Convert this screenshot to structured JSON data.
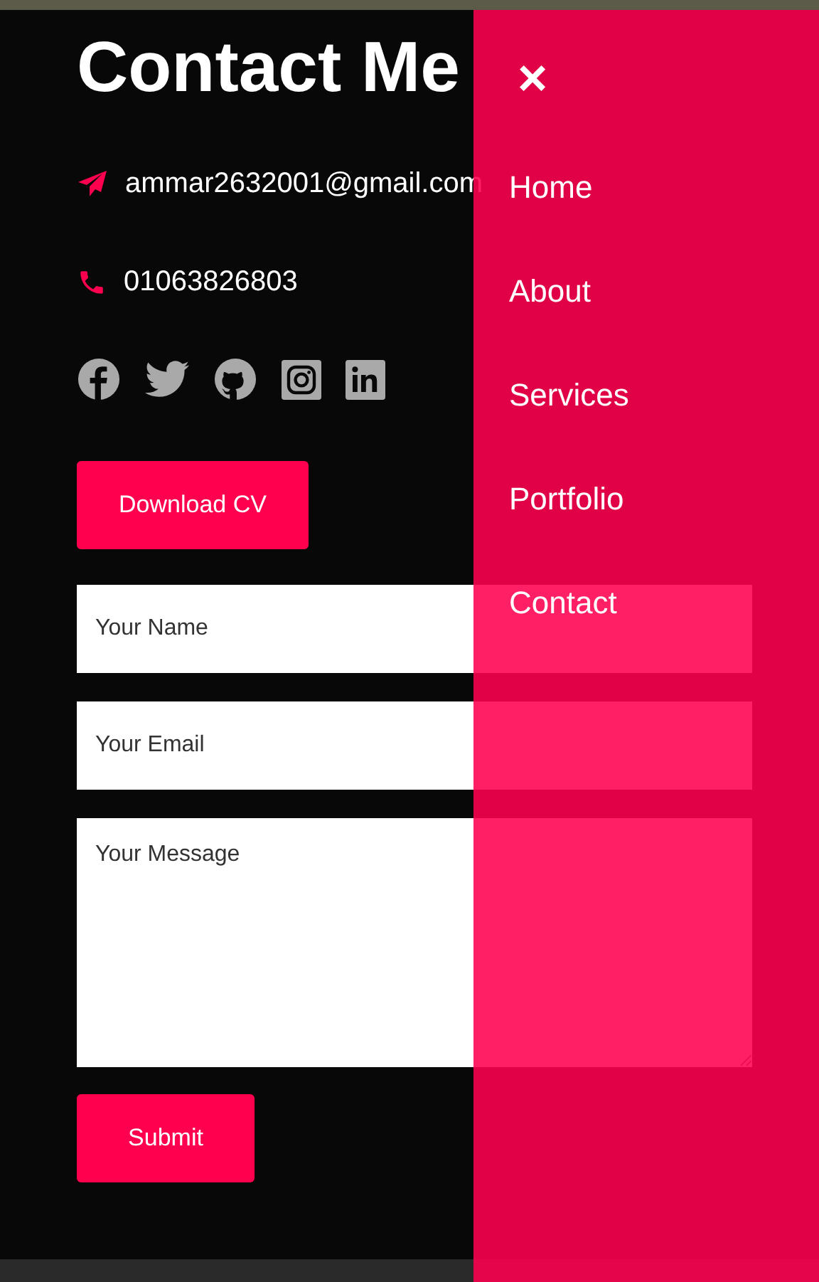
{
  "title": "Contact Me",
  "contacts": [
    {
      "kind": "email",
      "text": "ammar2632001@gmail.com"
    },
    {
      "kind": "phone",
      "text": "01063826803"
    }
  ],
  "download_button": "Download CV",
  "form": {
    "fields": [
      {
        "kind": "input",
        "placeholder": "Your Name"
      },
      {
        "kind": "input",
        "placeholder": "Your Email"
      },
      {
        "kind": "textarea",
        "placeholder": "Your Message"
      }
    ],
    "submit": "Submit"
  },
  "menu": {
    "close": "×",
    "items": [
      "Home",
      "About",
      "Services",
      "Portfolio",
      "Contact"
    ]
  }
}
